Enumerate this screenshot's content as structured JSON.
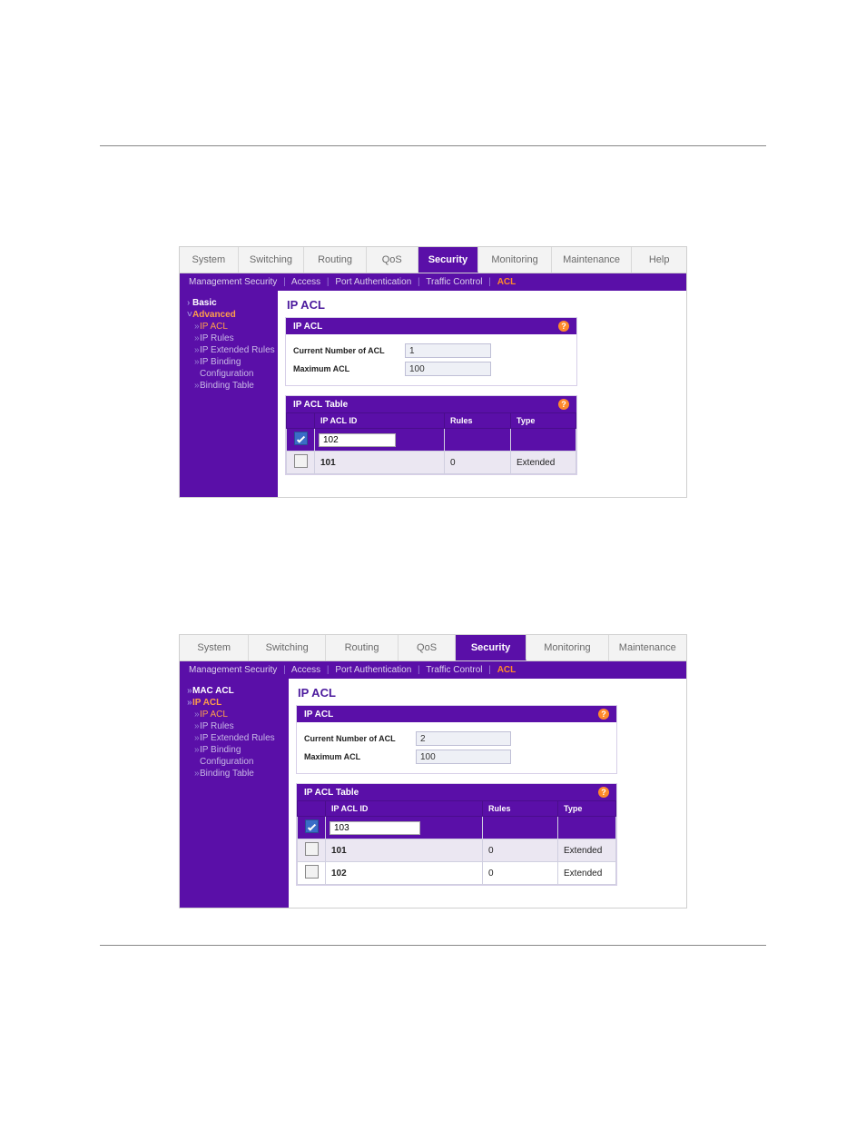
{
  "nav": {
    "items": [
      "System",
      "Switching",
      "Routing",
      "QoS",
      "Security",
      "Monitoring",
      "Maintenance",
      "Help"
    ],
    "active": "Security"
  },
  "nav2": {
    "items": [
      "System",
      "Switching",
      "Routing",
      "QoS",
      "Security",
      "Monitoring",
      "Maintenance"
    ],
    "active": "Security"
  },
  "subnav": {
    "items": [
      "Management Security",
      "Access",
      "Port Authentication",
      "Traffic Control",
      "ACL"
    ],
    "active": "ACL"
  },
  "sidebar1": {
    "items": [
      {
        "label": "Basic",
        "cls": "basic"
      },
      {
        "label": "Advanced",
        "cls": "advanced"
      },
      {
        "label": "IP ACL",
        "cls": "level2 selected",
        "chev": "»"
      },
      {
        "label": "IP Rules",
        "cls": "level2",
        "chev": "»"
      },
      {
        "label": "IP Extended Rules",
        "cls": "level2",
        "chev": "»"
      },
      {
        "label": "IP Binding",
        "cls": "level2",
        "chev": "»"
      },
      {
        "label": "Configuration",
        "cls": "level2"
      },
      {
        "label": "Binding Table",
        "cls": "level2",
        "chev": "»"
      }
    ]
  },
  "sidebar2": {
    "items": [
      {
        "label": "MAC ACL",
        "cls": "basic",
        "chev": "»"
      },
      {
        "label": "IP ACL",
        "cls": "advanced",
        "chev": "»"
      },
      {
        "label": "IP ACL",
        "cls": "level2 selected",
        "chev": "»"
      },
      {
        "label": "IP Rules",
        "cls": "level2",
        "chev": "»"
      },
      {
        "label": "IP Extended Rules",
        "cls": "level2",
        "chev": "»"
      },
      {
        "label": "IP Binding",
        "cls": "level2",
        "chev": "»"
      },
      {
        "label": "Configuration",
        "cls": "level2"
      },
      {
        "label": "Binding Table",
        "cls": "level2",
        "chev": "»"
      }
    ]
  },
  "page_title": "IP ACL",
  "panel1": {
    "title": "IP ACL",
    "rows": [
      {
        "label": "Current Number of ACL",
        "value": "1"
      },
      {
        "label": "Maximum ACL",
        "value": "100"
      }
    ]
  },
  "panel2": {
    "title": "IP ACL Table",
    "headers": [
      "",
      "IP ACL ID",
      "Rules",
      "Type"
    ],
    "rows": [
      {
        "checked": true,
        "id_input": "102",
        "rules": "",
        "type": ""
      },
      {
        "checked": false,
        "id": "101",
        "rules": "0",
        "type": "Extended"
      }
    ]
  },
  "panel1b": {
    "title": "IP ACL",
    "rows": [
      {
        "label": "Current Number of ACL",
        "value": "2"
      },
      {
        "label": "Maximum ACL",
        "value": "100"
      }
    ]
  },
  "panel2b": {
    "title": "IP ACL Table",
    "headers": [
      "",
      "IP ACL ID",
      "Rules",
      "Type"
    ],
    "rows": [
      {
        "checked": true,
        "id_input": "103",
        "rules": "",
        "type": ""
      },
      {
        "checked": false,
        "id": "101",
        "rules": "0",
        "type": "Extended"
      },
      {
        "checked": false,
        "id": "102",
        "rules": "0",
        "type": "Extended",
        "white": true
      }
    ]
  },
  "help_tooltip": "?"
}
